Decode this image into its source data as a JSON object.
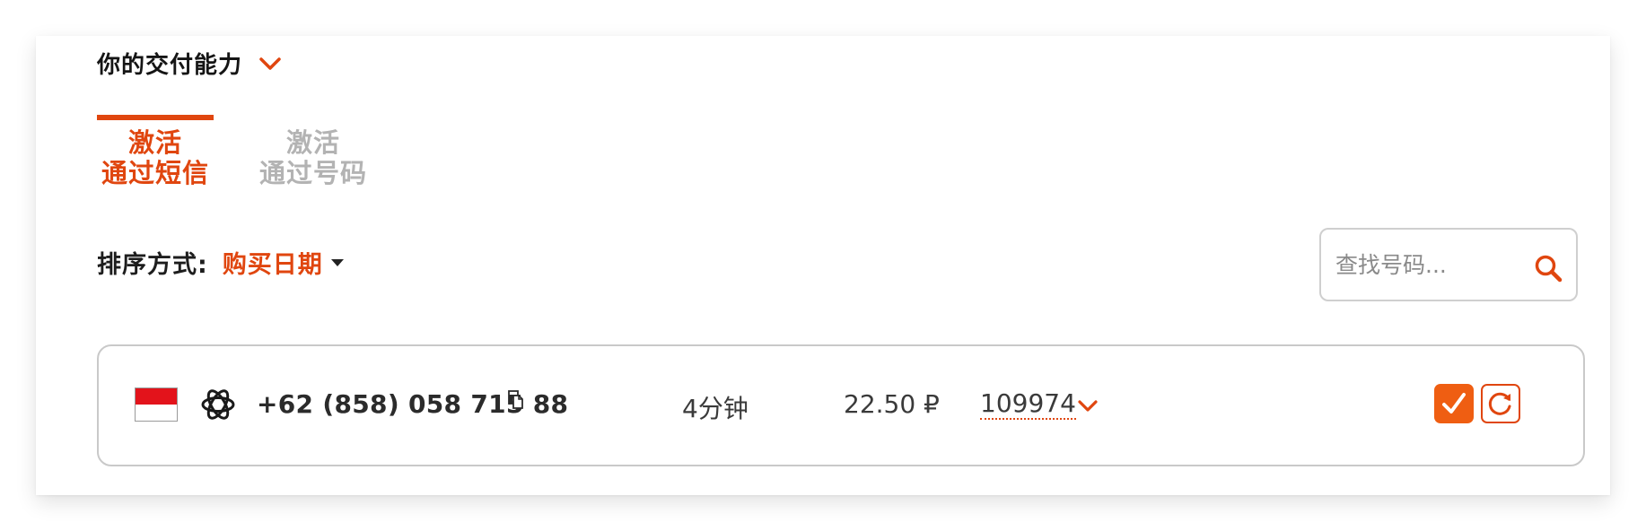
{
  "section": {
    "title": "你的交付能力"
  },
  "tabs": [
    {
      "line1": "激活",
      "line2": "通过短信",
      "active": true
    },
    {
      "line1": "激活",
      "line2": "通过号码",
      "active": false
    }
  ],
  "sort": {
    "label": "排序方式:",
    "value": "购买日期"
  },
  "search": {
    "placeholder": "查找号码..."
  },
  "order": {
    "country_flag": "indonesia-flag",
    "service_icon": "openai-icon",
    "phone": "+62 (858) 058 715 88",
    "duration": "4分钟",
    "price": "22.50 ₽",
    "code": "109974"
  },
  "colors": {
    "accent": "#e0460f",
    "accent_button": "#ef5e12",
    "inactive_tab": "#b3b3b3",
    "border": "#c9c9c9"
  }
}
